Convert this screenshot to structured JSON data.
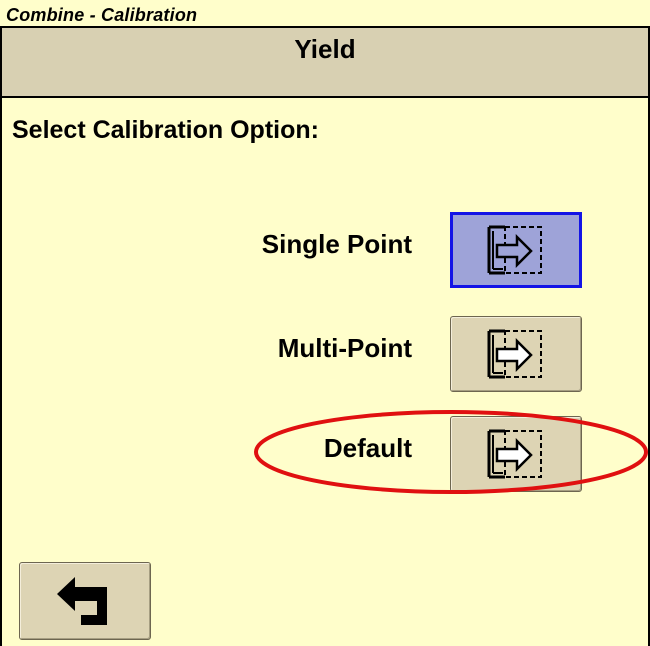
{
  "window": {
    "title": "Combine - Calibration"
  },
  "header": {
    "title": "Yield"
  },
  "main": {
    "prompt": "Select Calibration Option:",
    "options": [
      {
        "label": "Single Point",
        "icon": "enter-page-icon",
        "selected": true
      },
      {
        "label": "Multi-Point",
        "icon": "enter-page-icon",
        "selected": false
      },
      {
        "label": "Default",
        "icon": "enter-page-icon",
        "selected": false
      }
    ]
  },
  "footer": {
    "back_icon": "back-arrow-icon"
  },
  "colors": {
    "background": "#fffecb",
    "header_background": "#d8d0b2",
    "button_background": "#ddd4b4",
    "selected_button": "#9ea3d8",
    "selected_border": "#1414e6",
    "highlight": "#e01010"
  }
}
